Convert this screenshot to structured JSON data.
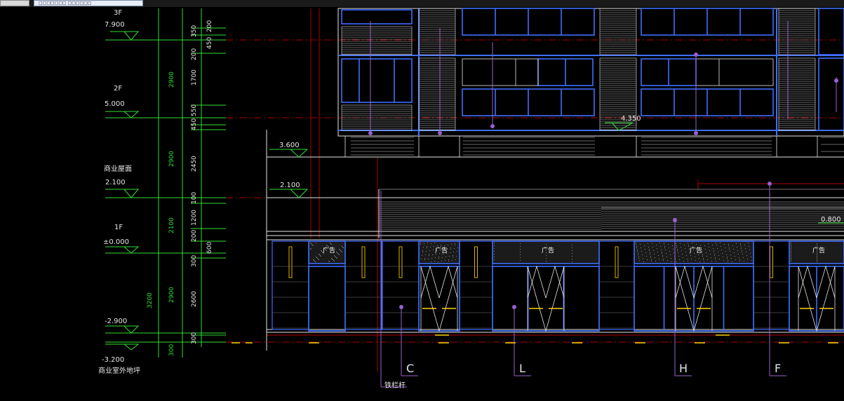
{
  "tabs": {
    "tab_a": "",
    "tab_b": "□□□□□□□ □□□□□□"
  },
  "levels": {
    "l3f": "3F",
    "l3f_el": "7.900",
    "l2f": "2F",
    "l2f_el": "5.000",
    "shop_roof": "商业屋面",
    "shop_roof_el": "2.100",
    "l1f": "1F",
    "l1f_el": "±0.000",
    "neg29": "-2.900",
    "neg32": "-3.200",
    "outdoor": "商业室外地坪"
  },
  "dims_outer": {
    "d2900a": "2900",
    "d2900b": "2900",
    "d2100": "2100",
    "d2900c": "2900",
    "d3200": "3200",
    "d300": "300"
  },
  "dims_inner": {
    "d200": "200",
    "d350": "350",
    "d450a": "450",
    "d200b": "200",
    "d1700": "1700",
    "d550": "550",
    "d450b": "450",
    "d2450": "2450",
    "d100": "100",
    "d1200": "1200",
    "d200c": "200",
    "d600": "600",
    "d300a": "300",
    "d2600": "2600",
    "d300b": "300"
  },
  "elevation_marks": {
    "e3600": "3.600",
    "e2100": "2.100",
    "e4350": "4.350",
    "e0800": "0.800"
  },
  "axes": [
    "C",
    "L",
    "H",
    "F"
  ],
  "ad_label": "广告",
  "note": "铁栏杆",
  "colors": {
    "background": "#000000",
    "level_line": "#33dd33",
    "window_frame": "#3f6fff",
    "facade": "#e6e6e6",
    "axis_line": "#c00000",
    "leader": "#9a5fd0",
    "accent": "#ffd400"
  }
}
